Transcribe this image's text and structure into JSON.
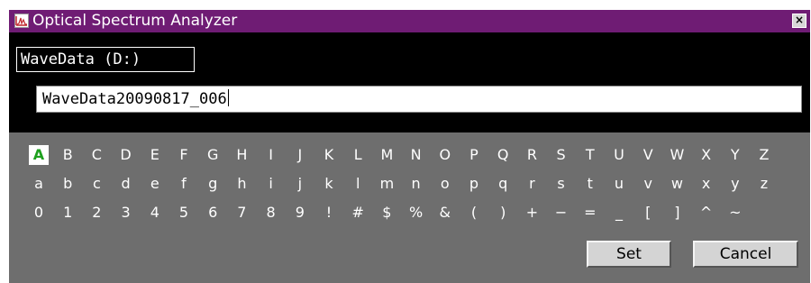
{
  "window": {
    "title": "Optical Spectrum Analyzer",
    "title_color": "#6f1c74"
  },
  "drive": {
    "label": "WaveData (D:)"
  },
  "filename": {
    "value": "WaveData20090817_006"
  },
  "keyboard": {
    "selected": "A",
    "selected_color": "#1ea01e",
    "rows": [
      [
        "A",
        "B",
        "C",
        "D",
        "E",
        "F",
        "G",
        "H",
        "I",
        "J",
        "K",
        "L",
        "M",
        "N",
        "O",
        "P",
        "Q",
        "R",
        "S",
        "T",
        "U",
        "V",
        "W",
        "X",
        "Y",
        "Z"
      ],
      [
        "a",
        "b",
        "c",
        "d",
        "e",
        "f",
        "g",
        "h",
        "i",
        "j",
        "k",
        "l",
        "m",
        "n",
        "o",
        "p",
        "q",
        "r",
        "s",
        "t",
        "u",
        "v",
        "w",
        "x",
        "y",
        "z"
      ],
      [
        "0",
        "1",
        "2",
        "3",
        "4",
        "5",
        "6",
        "7",
        "8",
        "9",
        "!",
        "#",
        "$",
        "%",
        "&",
        "(",
        ")",
        "+",
        "−",
        "=",
        "_",
        "[",
        "]",
        "^",
        "~"
      ]
    ]
  },
  "buttons": {
    "set": "Set",
    "cancel": "Cancel"
  },
  "icons": {
    "app": "spectrum-app-icon",
    "close": "close-icon"
  }
}
